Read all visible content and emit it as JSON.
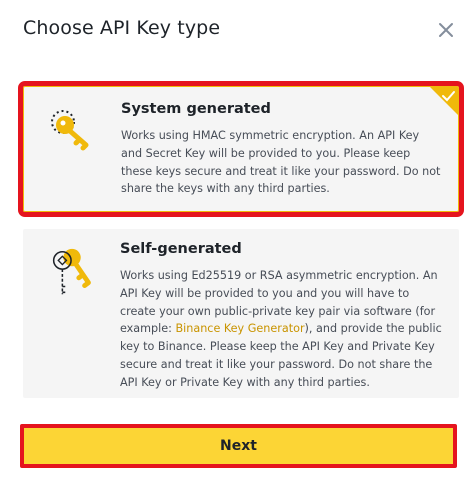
{
  "dialog": {
    "title": "Choose API Key type"
  },
  "options": [
    {
      "title": "System generated",
      "description": "Works using HMAC symmetric encryption. An API Key and Secret Key will be provided to you. Please keep these keys secure and treat it like your password. Do not share the keys with any third parties.",
      "selected": true
    },
    {
      "title": "Self-generated",
      "description_before_link": "Works using Ed25519 or RSA asymmetric encryption. An API Key will be provided to you and you will have to create your own public-private key pair via software (for example: ",
      "link_text": "Binance Key Generator",
      "description_after_link": "), and provide the public key to Binance. Please keep the API Key and Private Key secure and treat it like your password. Do not share the API Key or Private Key with any third parties.",
      "selected": false
    }
  ],
  "footer": {
    "next_label": "Next"
  },
  "colors": {
    "accent": "#fcd535",
    "gold": "#f0b90b",
    "highlight": "#e5141e",
    "link": "#c99400"
  },
  "icons": {
    "close": "close-icon",
    "system_key": "key-icon",
    "self_key": "key-pair-icon",
    "check": "check-icon"
  }
}
